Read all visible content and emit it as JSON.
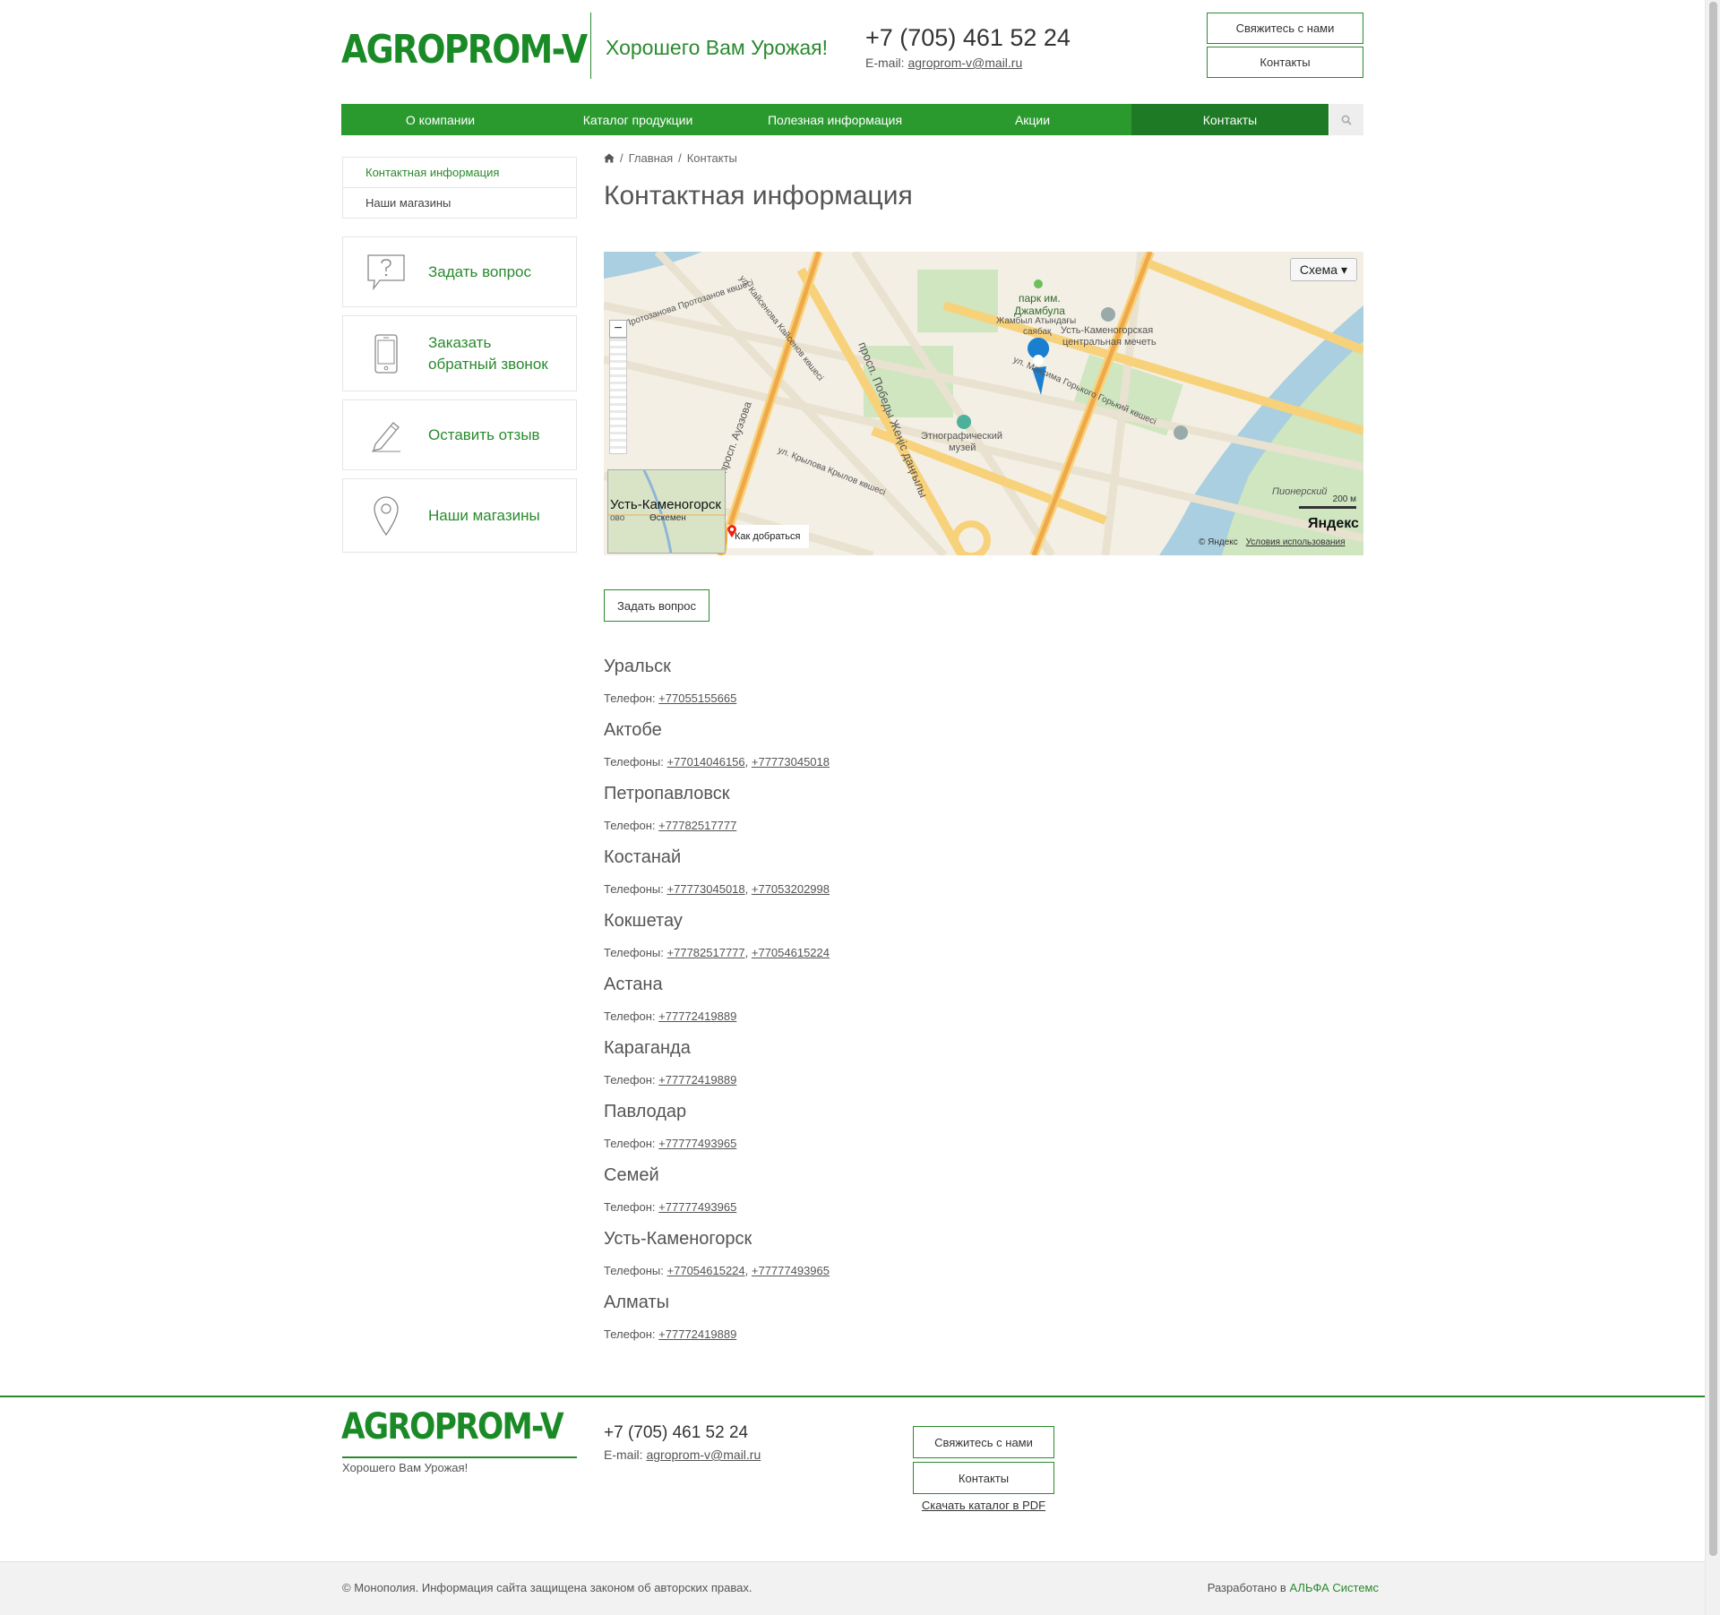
{
  "header": {
    "logo": "AGROPROM-V",
    "slogan": "Хорошего Вам Урожая!",
    "phone": "+7 (705) 461 52 24",
    "email_label": "E-mail:",
    "email": "agroprom-v@mail.ru",
    "contact_us_button": "Свяжитесь с нами",
    "contacts_button": "Контакты"
  },
  "nav": {
    "items": [
      "О компании",
      "Каталог продукции",
      "Полезная информация",
      "Акции",
      "Контакты"
    ],
    "active": "Контакты",
    "search_icon": "search-icon"
  },
  "sidebar": {
    "menu": [
      "Контактная информация",
      "Наши магазины"
    ],
    "cards": [
      {
        "label": "Задать вопрос",
        "icon": "question-bubble-icon"
      },
      {
        "label_line1": "Заказать",
        "label_line2": "обратный звонок",
        "icon": "phone-icon"
      },
      {
        "label": "Оставить отзыв",
        "icon": "pencil-icon"
      },
      {
        "label": "Наши магазины",
        "icon": "map-pin-icon"
      }
    ]
  },
  "breadcrumb": {
    "home_icon": "home-icon",
    "items": [
      "Главная",
      "Контакты"
    ],
    "separator": "/"
  },
  "page_title": "Контактная информация",
  "map": {
    "type_button": "Схема ▾",
    "labels": {
      "park": "парк им.",
      "park2": "Джамбула",
      "park3": "Жамбыл Атындағы",
      "park4": "саябақ",
      "mosque1": "Усть-Каменогорская",
      "mosque2": "центральная мечеть",
      "museum1": "Этнографический",
      "museum2": "музей",
      "street1": "ул. Протозанова Протозанов көшесі",
      "street2": "ул. Кайсенова Кайсенов көшесі",
      "street3": "просп. Победы Жеңіс даңғылы",
      "street4": "просп. Ауэзова",
      "street5": "ул. Крылова Крылов көшесі",
      "street6": "ул. Максима Горького Горький көшесі",
      "district": "Пионерский"
    },
    "minimap_city": "Усть-Каменогорск",
    "minimap_sub": "Өскемен",
    "minimap_left": "ово",
    "route": "Как добраться",
    "scale": "200 м",
    "brand": "Яндекс",
    "copyright": "© Яндекс",
    "terms": "Условия использования"
  },
  "ask_button": "Задать вопрос",
  "cities": [
    {
      "name": "Уральск",
      "label": "Телефон:",
      "phones": [
        "+77055155665"
      ]
    },
    {
      "name": "Актобе",
      "label": "Телефоны:",
      "phones": [
        "+77014046156",
        "+77773045018"
      ]
    },
    {
      "name": "Петропавловск",
      "label": "Телефон:",
      "phones": [
        "+77782517777"
      ]
    },
    {
      "name": "Костанай",
      "label": "Телефоны:",
      "phones": [
        "+77773045018",
        "+77053202998"
      ]
    },
    {
      "name": "Кокшетау",
      "label": "Телефоны:",
      "phones": [
        "+77782517777",
        "+77054615224"
      ]
    },
    {
      "name": "Астана",
      "label": "Телефон:",
      "phones": [
        "+77772419889"
      ]
    },
    {
      "name": "Караганда",
      "label": "Телефон:",
      "phones": [
        "+77772419889"
      ]
    },
    {
      "name": "Павлодар",
      "label": "Телефон:",
      "phones": [
        "+77777493965"
      ]
    },
    {
      "name": "Семей",
      "label": "Телефон:",
      "phones": [
        "+77777493965"
      ]
    },
    {
      "name": "Усть-Каменогорск",
      "label": "Телефоны:",
      "phones": [
        "+77054615224",
        "+77777493965"
      ]
    },
    {
      "name": "Алматы",
      "label": "Телефон:",
      "phones": [
        "+77772419889"
      ]
    }
  ],
  "footer": {
    "logo": "AGROPROM-V",
    "slogan": "Хорошего Вам Урожая!",
    "phone": "+7 (705) 461 52 24",
    "email_label": "E-mail:",
    "email": "agroprom-v@mail.ru",
    "contact_us_button": "Свяжитесь с нами",
    "contacts_button": "Контакты",
    "pdf_link": "Скачать каталог в PDF",
    "copyright": "© Монополия. Информация сайта защищена законом об авторских правах.",
    "developer_label": "Разработано в",
    "developer_name": "АЛЬФА Системс"
  },
  "colors": {
    "brand_green": "#2a9a2f",
    "active_nav": "#1e7a24",
    "accent_text": "#2a8a2e"
  }
}
